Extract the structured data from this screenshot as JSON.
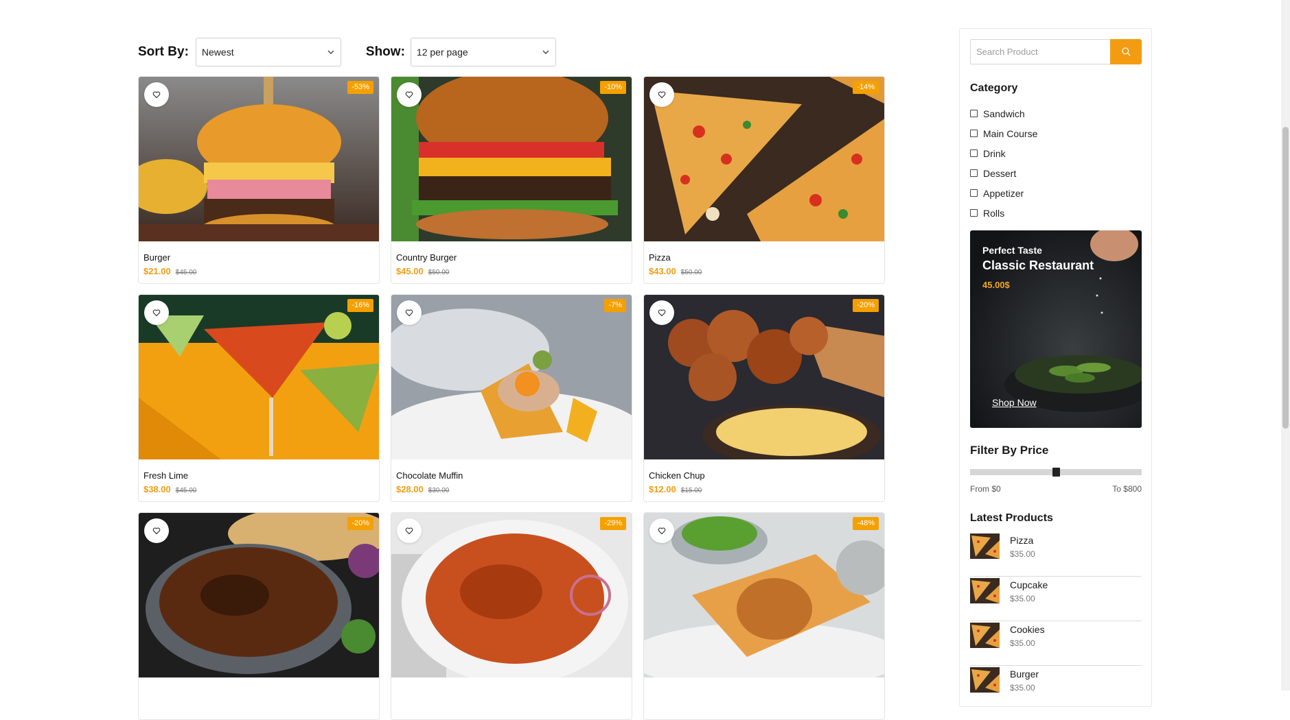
{
  "toolbar": {
    "sort_label": "Sort By:",
    "sort_value": "Newest",
    "show_label": "Show:",
    "show_value": "12 per page"
  },
  "products": [
    {
      "name": "Burger",
      "price": "$21.00",
      "old_price": "$45.00",
      "discount": "-53%",
      "image": "burger"
    },
    {
      "name": "Country Burger",
      "price": "$45.00",
      "old_price": "$50.00",
      "discount": "-10%",
      "image": "country-burger"
    },
    {
      "name": "Pizza",
      "price": "$43.00",
      "old_price": "$50.00",
      "discount": "-14%",
      "image": "pizza"
    },
    {
      "name": "Fresh Lime",
      "price": "$38.00",
      "old_price": "$45.00",
      "discount": "-16%",
      "image": "cocktail"
    },
    {
      "name": "Chocolate Muffin",
      "price": "$28.00",
      "old_price": "$30.00",
      "discount": "-7%",
      "image": "plated-dish"
    },
    {
      "name": "Chicken Chup",
      "price": "$12.00",
      "old_price": "$15.00",
      "discount": "-20%",
      "image": "fried-chicken"
    },
    {
      "name": "",
      "price": "",
      "old_price": "",
      "discount": "-20%",
      "image": "curry"
    },
    {
      "name": "",
      "price": "",
      "old_price": "",
      "discount": "-29%",
      "image": "biryani"
    },
    {
      "name": "",
      "price": "",
      "old_price": "",
      "discount": "-48%",
      "image": "wrap"
    }
  ],
  "sidebar": {
    "search_placeholder": "Search Product",
    "category_title": "Category",
    "categories": [
      "Sandwich",
      "Main Course",
      "Drink",
      "Dessert",
      "Appetizer",
      "Rolls"
    ],
    "promo": {
      "subtitle": "Perfect Taste",
      "title": "Classic Restaurant",
      "price": "45.00$",
      "cta": "Shop Now"
    },
    "filter_title": "Filter By Price",
    "price_range": {
      "from_label": "From $0",
      "to_label": "To $800",
      "handle_fraction": 0.5
    },
    "latest_title": "Latest Products",
    "latest": [
      {
        "name": "Pizza",
        "price": "$35.00"
      },
      {
        "name": "Cupcake",
        "price": "$35.00"
      },
      {
        "name": "Cookies",
        "price": "$35.00"
      },
      {
        "name": "Burger",
        "price": "$35.00"
      }
    ]
  },
  "colors": {
    "accent": "#f39c12",
    "badge": "#f5a000"
  }
}
